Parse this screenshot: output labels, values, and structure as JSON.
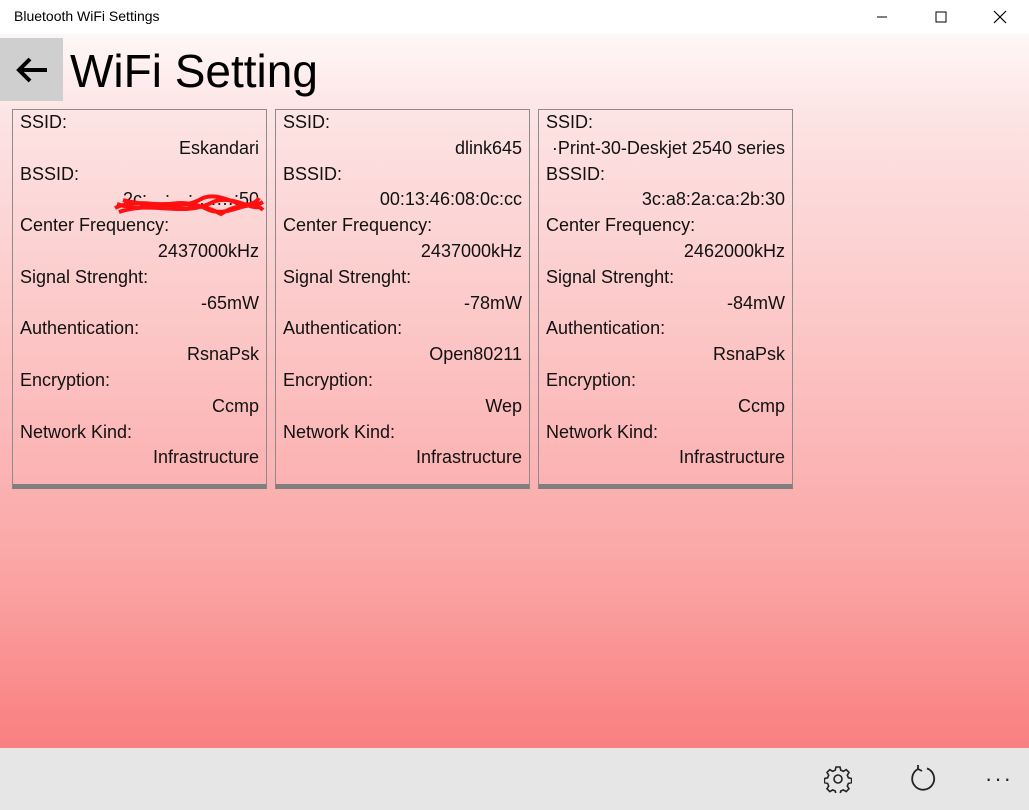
{
  "window": {
    "title": "Bluetooth WiFi Settings"
  },
  "header": {
    "title": "WiFi Setting"
  },
  "labels": {
    "ssid": "SSID:",
    "bssid": "BSSID:",
    "frequency": "Center Frequency:",
    "signal": "Signal Strenght:",
    "auth": "Authentication:",
    "encryption": "Encryption:",
    "kind": "Network Kind:"
  },
  "networks": [
    {
      "ssid": "Eskandari",
      "bssid": "2c:…:…:…:…:50",
      "bssid_redacted": true,
      "frequency": "2437000kHz",
      "signal": "-65mW",
      "auth": "RsnaPsk",
      "encryption": "Ccmp",
      "kind": "Infrastructure"
    },
    {
      "ssid": "dlink645",
      "bssid": "00:13:46:08:0c:cc",
      "frequency": "2437000kHz",
      "signal": "-78mW",
      "auth": "Open80211",
      "encryption": "Wep",
      "kind": "Infrastructure"
    },
    {
      "ssid": "·Print-30-Deskjet 2540 series",
      "bssid": "3c:a8:2a:ca:2b:30",
      "frequency": "2462000kHz",
      "signal": "-84mW",
      "auth": "RsnaPsk",
      "encryption": "Ccmp",
      "kind": "Infrastructure"
    }
  ],
  "appbar": {
    "icons": [
      "settings-icon",
      "refresh-icon",
      "more-icon"
    ],
    "more_label": "···"
  },
  "colors": {
    "gradient_top": "#ffffff",
    "gradient_bottom": "#f97f7f",
    "appbar": "#e6e6e6",
    "back_button": "#cfcfcf",
    "redaction": "#ff0000"
  }
}
